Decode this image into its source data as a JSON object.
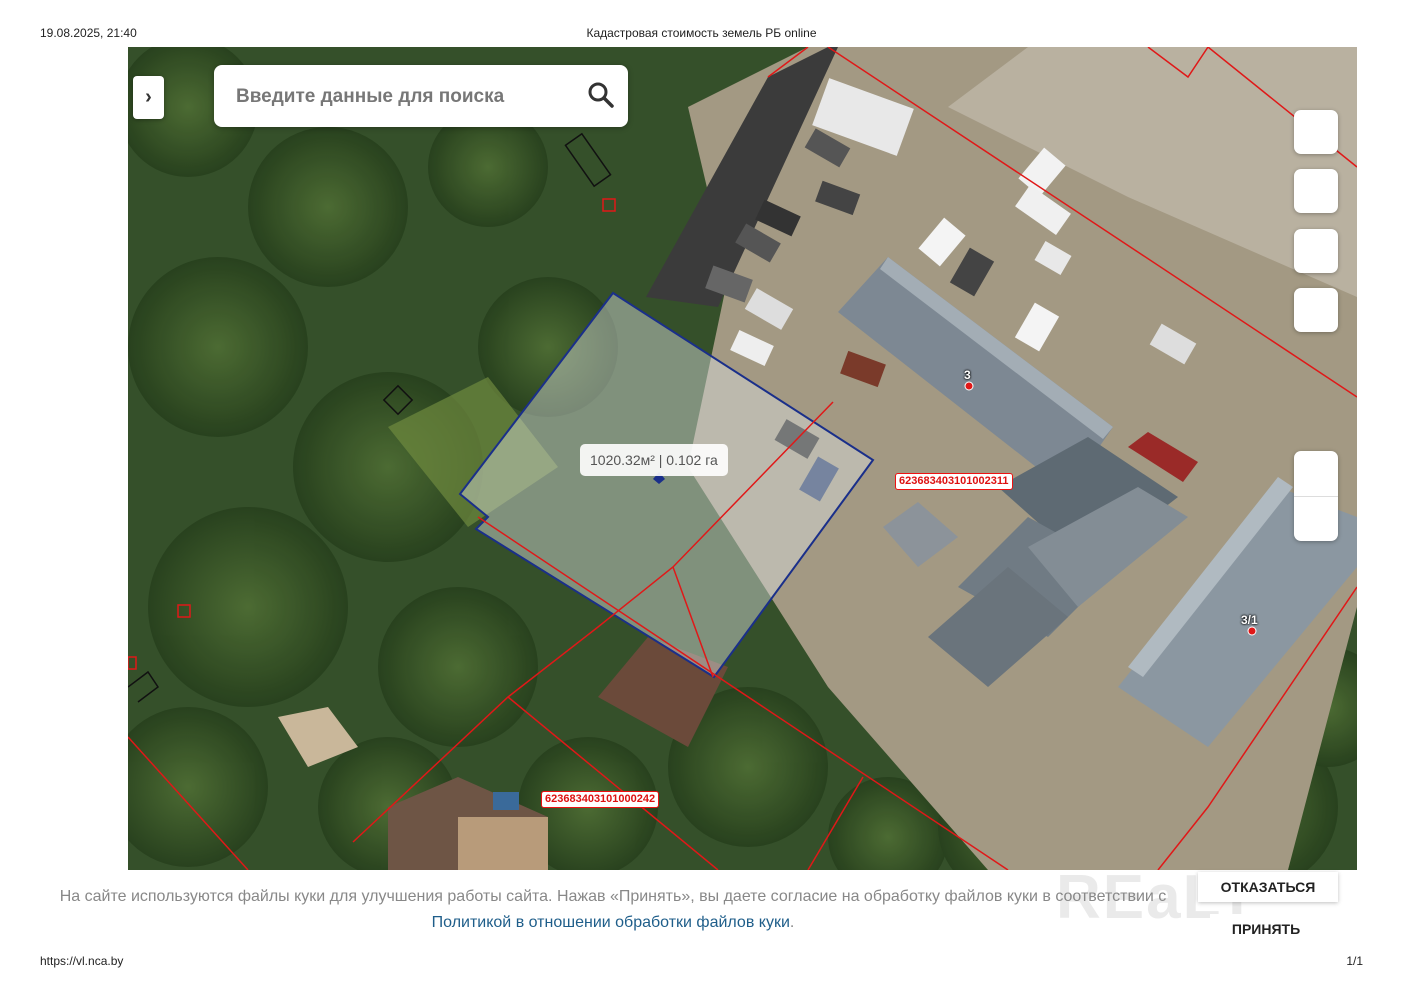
{
  "print_header": {
    "datetime": "19.08.2025, 21:40",
    "title": "Кадастровая стоимость земель РБ online"
  },
  "print_footer": {
    "url": "https://vl.nca.by",
    "page": "1/1"
  },
  "search": {
    "placeholder": "Введите данные для поиска"
  },
  "map": {
    "selected_parcel_area": "1020.32м² | 0.102 га",
    "cadastral_labels": [
      "623683403101002311",
      "623683403101000242"
    ],
    "address_markers": [
      "3",
      "3/1"
    ]
  },
  "cookie_banner": {
    "text_before": "На сайте используются файлы куки для улучшения работы сайта. Нажав «Принять», вы даете согласие на обработку файлов куки в соответствии с ",
    "link_text": "Политикой в отношении обработки файлов куки",
    "text_after": ".",
    "decline_label": "ОТКАЗАТЬСЯ",
    "accept_label": "ПРИНЯТЬ",
    "watermark": "REaLT"
  },
  "colors": {
    "parcel_boundary": "#e01818",
    "selected_parcel": "#1a2f8a",
    "cookie_link": "#1f5e8a"
  }
}
